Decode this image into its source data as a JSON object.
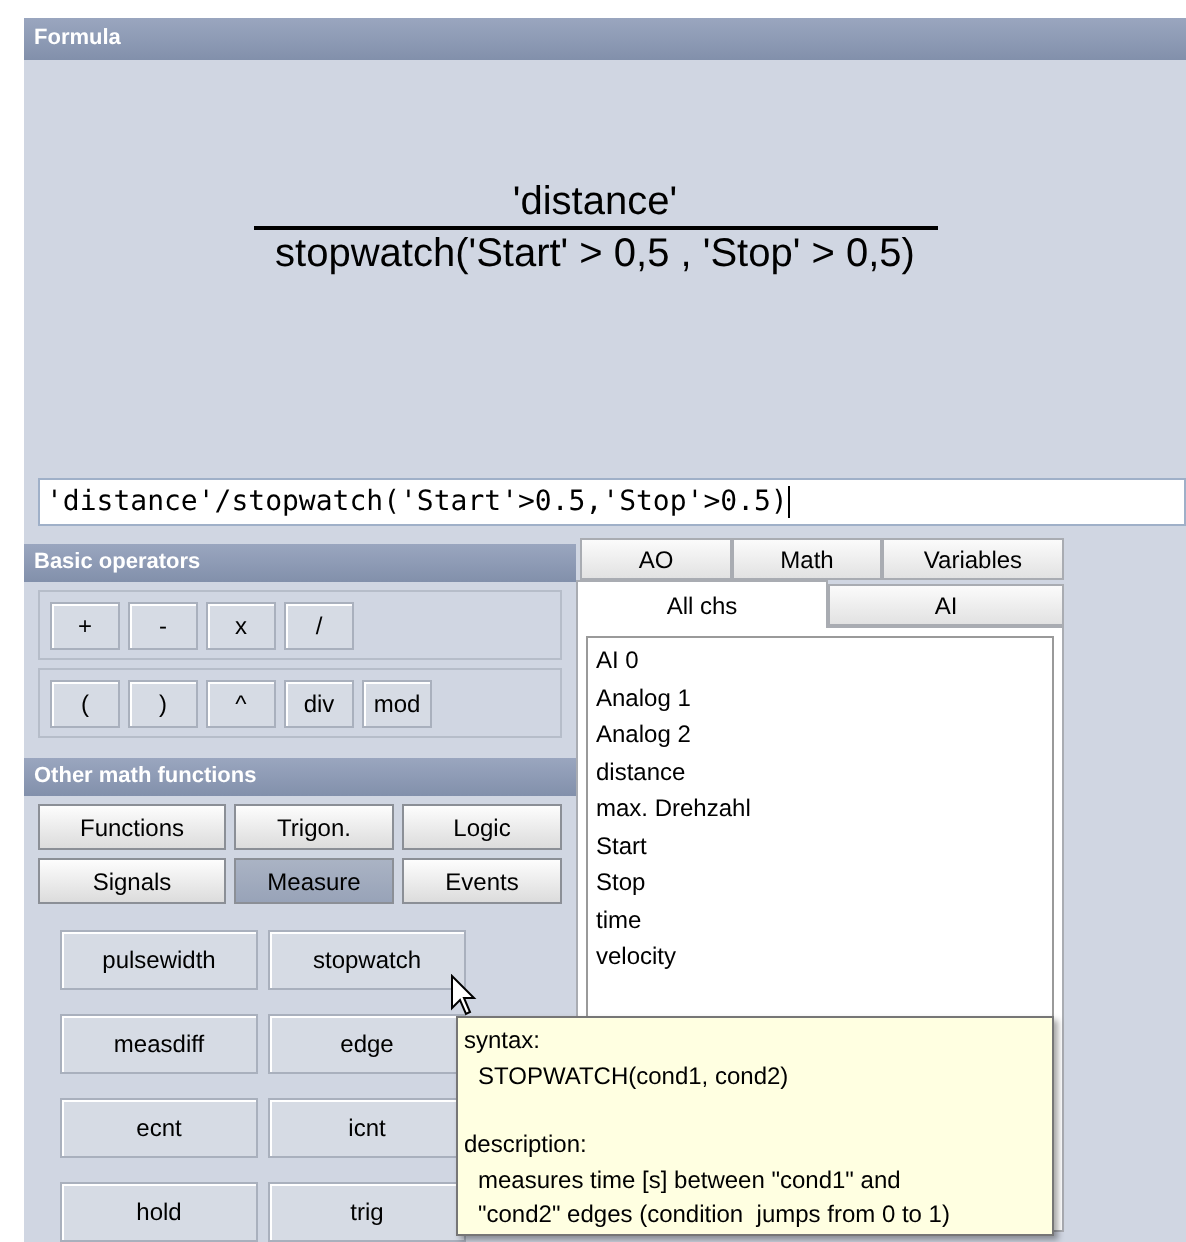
{
  "formula": {
    "title": "Formula",
    "numerator": "'distance'",
    "denominator": "stopwatch('Start' > 0,5 , 'Stop' > 0,5)",
    "expression": "'distance'/stopwatch('Start'>0.5,'Stop'>0.5)"
  },
  "basic_operators": {
    "title": "Basic operators",
    "groups": [
      [
        "+",
        "-",
        "x",
        "/"
      ],
      [
        "(",
        ")",
        "^",
        "div",
        "mod"
      ]
    ]
  },
  "other_math": {
    "title": "Other math functions",
    "categories": [
      {
        "label": "Functions",
        "selected": false
      },
      {
        "label": "Trigon.",
        "selected": false
      },
      {
        "label": "Logic",
        "selected": false
      },
      {
        "label": "Signals",
        "selected": false
      },
      {
        "label": "Measure",
        "selected": true
      },
      {
        "label": "Events",
        "selected": false
      }
    ],
    "functions": [
      "pulsewidth",
      "stopwatch",
      "measdiff",
      "edge",
      "ecnt",
      "icnt",
      "hold",
      "trig"
    ]
  },
  "channel_tabs": {
    "back_row": [
      {
        "label": "AO",
        "selected": false
      },
      {
        "label": "Math",
        "selected": false
      },
      {
        "label": "Variables",
        "selected": false
      }
    ],
    "front_row": [
      {
        "label": "All chs",
        "selected": true
      },
      {
        "label": "AI",
        "selected": false
      }
    ]
  },
  "channels": [
    "AI 0",
    "Analog 1",
    "Analog 2",
    "distance",
    "max. Drehzahl",
    "Start",
    "Stop",
    "time",
    "velocity"
  ],
  "tooltip": {
    "syntax_label": "syntax:",
    "syntax": "STOPWATCH(cond1, cond2)",
    "description_label": "description:",
    "description": [
      "measures time [s] between \"cond1\" and",
      "\"cond2\" edges (condition  jumps from 0 to 1)"
    ]
  }
}
